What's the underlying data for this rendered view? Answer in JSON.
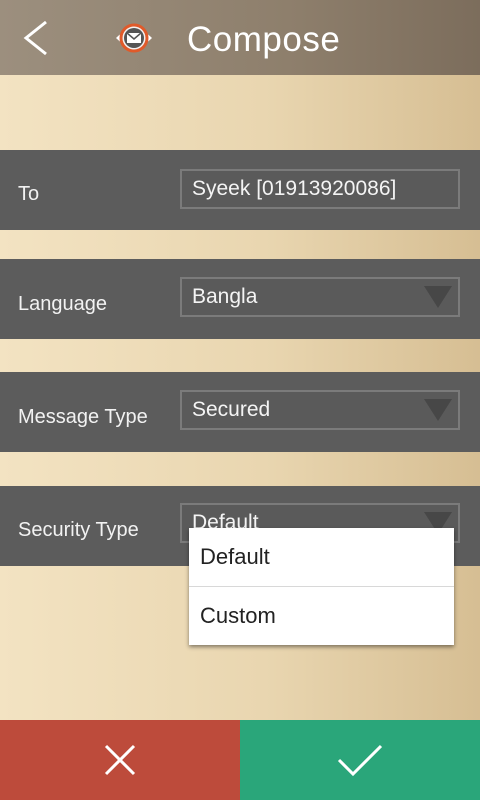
{
  "header": {
    "title": "Compose",
    "back_icon": "back-chevron-icon",
    "logo_icon": "mail-eye-logo-icon"
  },
  "form": {
    "to": {
      "label": "To",
      "value": "Syeek [01913920086]"
    },
    "language": {
      "label": "Language",
      "value": "Bangla"
    },
    "message_type": {
      "label": "Message Type",
      "value": "Secured"
    },
    "security_type": {
      "label": "Security Type",
      "value": "Default"
    }
  },
  "dropdown": {
    "options": [
      "Default",
      "Custom"
    ]
  },
  "footer": {
    "cancel_icon": "close-icon",
    "confirm_icon": "check-icon",
    "cancel_color": "#bd4b3b",
    "confirm_color": "#2aa67a"
  }
}
